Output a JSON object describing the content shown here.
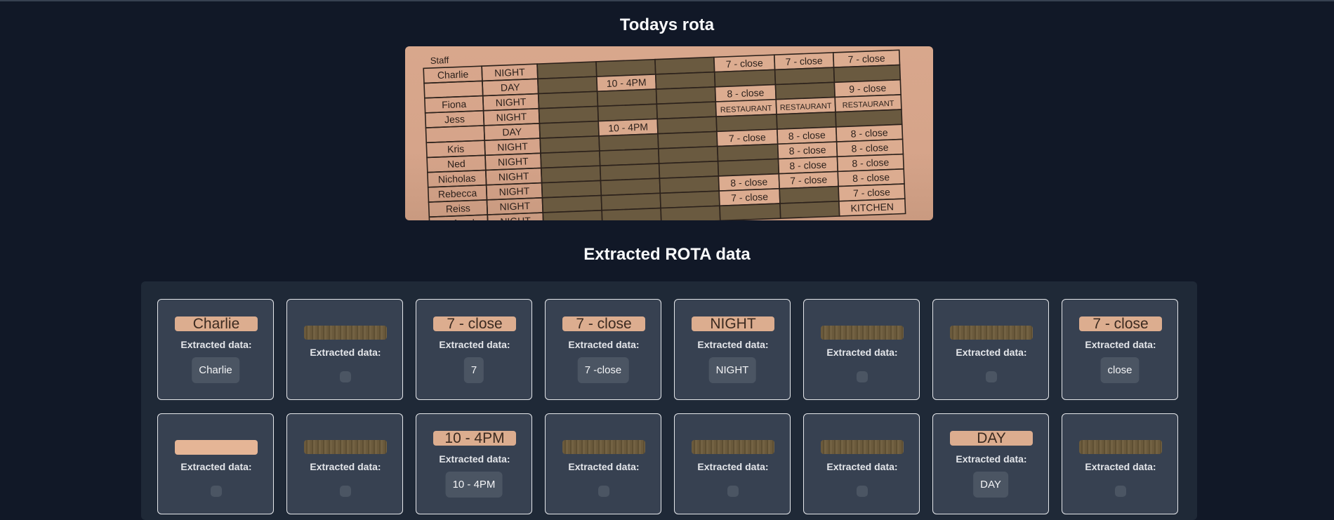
{
  "page": {
    "title": "Todays rota",
    "extracted_title": "Extracted ROTA data"
  },
  "rota_image": {
    "header": "Staff",
    "rows": [
      {
        "name": "Charlie",
        "shift": "NIGHT",
        "cells": [
          "",
          "",
          "",
          "7 - close",
          "7 - close",
          "7 - close"
        ]
      },
      {
        "name": "",
        "shift": "DAY",
        "cells": [
          "",
          "10 - 4PM",
          "",
          "",
          "",
          ""
        ]
      },
      {
        "name": "Fiona",
        "shift": "NIGHT",
        "cells": [
          "",
          "",
          "",
          "8 - close",
          "",
          "9 - close"
        ]
      },
      {
        "name": "Jess",
        "shift": "NIGHT",
        "cells": [
          "",
          "",
          "",
          "RESTAURANT",
          "RESTAURANT",
          "RESTAURANT"
        ]
      },
      {
        "name": "",
        "shift": "DAY",
        "cells": [
          "",
          "10 - 4PM",
          "",
          "",
          "",
          ""
        ]
      },
      {
        "name": "Kris",
        "shift": "NIGHT",
        "cells": [
          "",
          "",
          "",
          "7 - close",
          "8 - close",
          "8 - close"
        ]
      },
      {
        "name": "Ned",
        "shift": "NIGHT",
        "cells": [
          "",
          "",
          "",
          "",
          "8 - close",
          "8 - close"
        ]
      },
      {
        "name": "Nicholas",
        "shift": "NIGHT",
        "cells": [
          "",
          "",
          "",
          "",
          "8 - close",
          "8 - close"
        ]
      },
      {
        "name": "Rebecca",
        "shift": "NIGHT",
        "cells": [
          "",
          "",
          "",
          "8 - close",
          "7 - close",
          "8 - close"
        ]
      },
      {
        "name": "Reiss",
        "shift": "NIGHT",
        "cells": [
          "",
          "",
          "",
          "7 - close",
          "",
          "7 - close"
        ]
      },
      {
        "name": "Tufayel",
        "shift": "NIGHT",
        "cells": [
          "",
          "",
          "",
          "",
          "",
          "KITCHEN"
        ]
      }
    ]
  },
  "extracted_label": "Extracted data:",
  "cards": [
    {
      "crop_text": "Charlie",
      "crop_style": "light",
      "value": "Charlie"
    },
    {
      "crop_text": "",
      "crop_style": "dark",
      "value": ""
    },
    {
      "crop_text": "7 - close",
      "crop_style": "light",
      "value": "7"
    },
    {
      "crop_text": "7 - close",
      "crop_style": "light",
      "value": "7 -close"
    },
    {
      "crop_text": "NIGHT",
      "crop_style": "light",
      "value": "NIGHT"
    },
    {
      "crop_text": "",
      "crop_style": "dark",
      "value": ""
    },
    {
      "crop_text": "",
      "crop_style": "dark",
      "value": ""
    },
    {
      "crop_text": "7 - close",
      "crop_style": "light",
      "value": "close"
    },
    {
      "crop_text": "",
      "crop_style": "blank",
      "value": ""
    },
    {
      "crop_text": "",
      "crop_style": "dark",
      "value": ""
    },
    {
      "crop_text": "10 - 4PM",
      "crop_style": "light",
      "value": "10 - 4PM"
    },
    {
      "crop_text": "",
      "crop_style": "dark",
      "value": ""
    },
    {
      "crop_text": "",
      "crop_style": "dark",
      "value": ""
    },
    {
      "crop_text": "",
      "crop_style": "dark",
      "value": ""
    },
    {
      "crop_text": "DAY",
      "crop_style": "light",
      "value": "DAY"
    },
    {
      "crop_text": "",
      "crop_style": "dark",
      "value": ""
    }
  ]
}
